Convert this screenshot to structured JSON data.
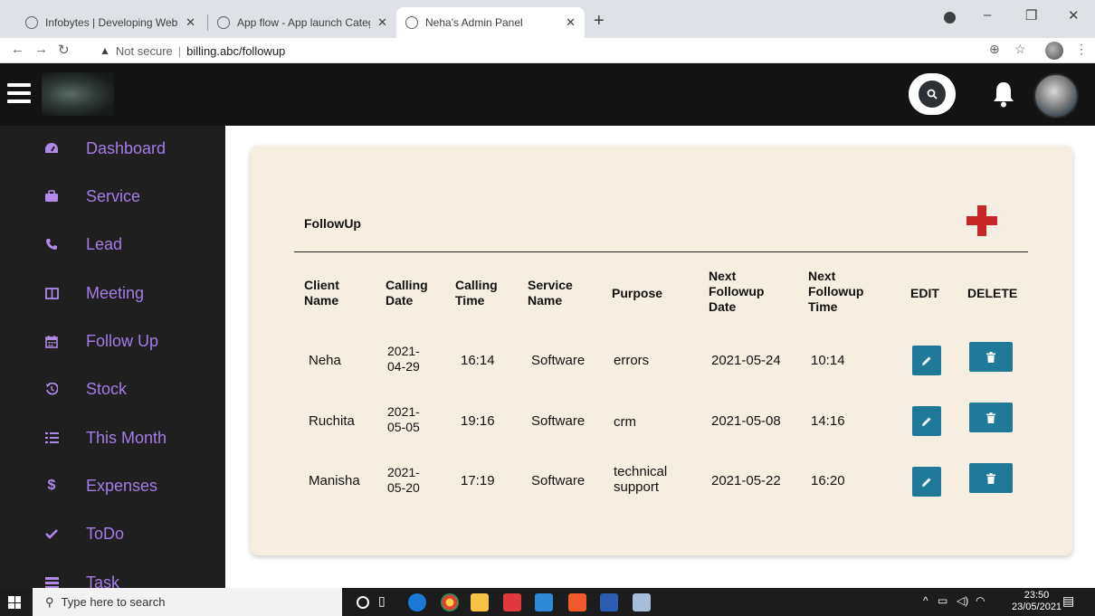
{
  "browser": {
    "tabs": [
      {
        "title": "Infobytes | Developing Websites",
        "active": false
      },
      {
        "title": "App flow - App launch Category",
        "active": false
      },
      {
        "title": "Neha's Admin Panel",
        "active": true
      }
    ],
    "security_label": "Not secure",
    "url": "billing.abc/followup"
  },
  "sidebar": {
    "items": [
      {
        "label": "Dashboard",
        "icon": "dashboard-icon"
      },
      {
        "label": "Service",
        "icon": "briefcase-icon"
      },
      {
        "label": "Lead",
        "icon": "phone-icon"
      },
      {
        "label": "Meeting",
        "icon": "columns-icon"
      },
      {
        "label": "Follow Up",
        "icon": "calendar-icon"
      },
      {
        "label": "Stock",
        "icon": "history-icon"
      },
      {
        "label": "This Month",
        "icon": "list-ol-icon"
      },
      {
        "label": "Expenses",
        "icon": "dollar-icon"
      },
      {
        "label": "ToDo",
        "icon": "check-icon"
      },
      {
        "label": "Task",
        "icon": "tasks-icon"
      }
    ]
  },
  "main": {
    "title": "FollowUp",
    "columns": [
      [
        "Client",
        "Name"
      ],
      [
        "Calling",
        "Date"
      ],
      [
        "Calling",
        "Time"
      ],
      [
        "Service",
        "Name"
      ],
      [
        "Purpose"
      ],
      [
        "Next",
        "Followup",
        "Date"
      ],
      [
        "Next",
        "Followup",
        "Time"
      ],
      [
        "EDIT"
      ],
      [
        "DELETE"
      ]
    ],
    "rows": [
      {
        "client": "Neha",
        "calling_date": [
          "2021-",
          "04-29"
        ],
        "calling_time": "16:14",
        "service": "Software",
        "purpose": [
          "errors"
        ],
        "next_date": "2021-05-24",
        "next_time": "10:14"
      },
      {
        "client": "Ruchita",
        "calling_date": [
          "2021-",
          "05-05"
        ],
        "calling_time": "19:16",
        "service": "Software",
        "purpose": [
          "crm"
        ],
        "next_date": "2021-05-08",
        "next_time": "14:16"
      },
      {
        "client": "Manisha",
        "calling_date": [
          "2021-",
          "05-20"
        ],
        "calling_time": "17:19",
        "service": "Software",
        "purpose": [
          "technical",
          "support"
        ],
        "next_date": "2021-05-22",
        "next_time": "16:20"
      }
    ]
  },
  "taskbar": {
    "search_placeholder": "Type here to search",
    "time": "23:50",
    "date": "23/05/2021"
  },
  "colors": {
    "sidebar_text": "#a57be6",
    "card_bg": "#f6efe1",
    "action_button": "#1f7a9a",
    "add_icon": "#c62828"
  }
}
